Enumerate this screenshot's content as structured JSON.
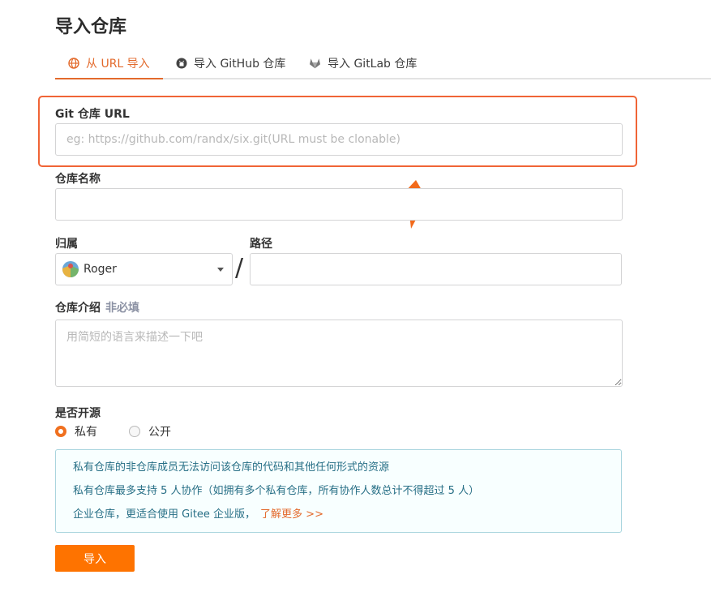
{
  "page": {
    "title": "导入仓库"
  },
  "tabs": [
    {
      "label": "从 URL 导入",
      "icon": "globe-icon",
      "active": true
    },
    {
      "label": "导入 GitHub 仓库",
      "icon": "github-icon",
      "active": false
    },
    {
      "label": "导入 GitLab 仓库",
      "icon": "gitlab-icon",
      "active": false
    }
  ],
  "form": {
    "git_url": {
      "label": "Git 仓库 URL",
      "placeholder": "eg: https://github.com/randx/six.git(URL must be clonable)",
      "value": ""
    },
    "repo_name": {
      "label": "仓库名称",
      "value": ""
    },
    "owner": {
      "label": "归属",
      "selected": "Roger"
    },
    "path": {
      "label": "路径",
      "value": ""
    },
    "path_separator": "/",
    "description": {
      "label": "仓库介绍",
      "optional_label": "非必填",
      "placeholder": "用简短的语言来描述一下吧",
      "value": ""
    },
    "visibility": {
      "label": "是否开源",
      "options": [
        {
          "label": "私有",
          "selected": true
        },
        {
          "label": "公开",
          "selected": false
        }
      ]
    }
  },
  "info": {
    "lines": [
      "私有仓库的非仓库成员无法访问该仓库的代码和其他任何形式的资源",
      "私有仓库最多支持 5 人协作（如拥有多个私有仓库，所有协作人数总计不得超过 5 人）",
      "企业仓库，更适合使用 Gitee 企业版，"
    ],
    "link": "了解更多 >>"
  },
  "submit_label": "导入",
  "colors": {
    "accent": "#e36a2c",
    "highlight": "#f06436",
    "button": "#fe7300",
    "info_text": "#276f86"
  }
}
